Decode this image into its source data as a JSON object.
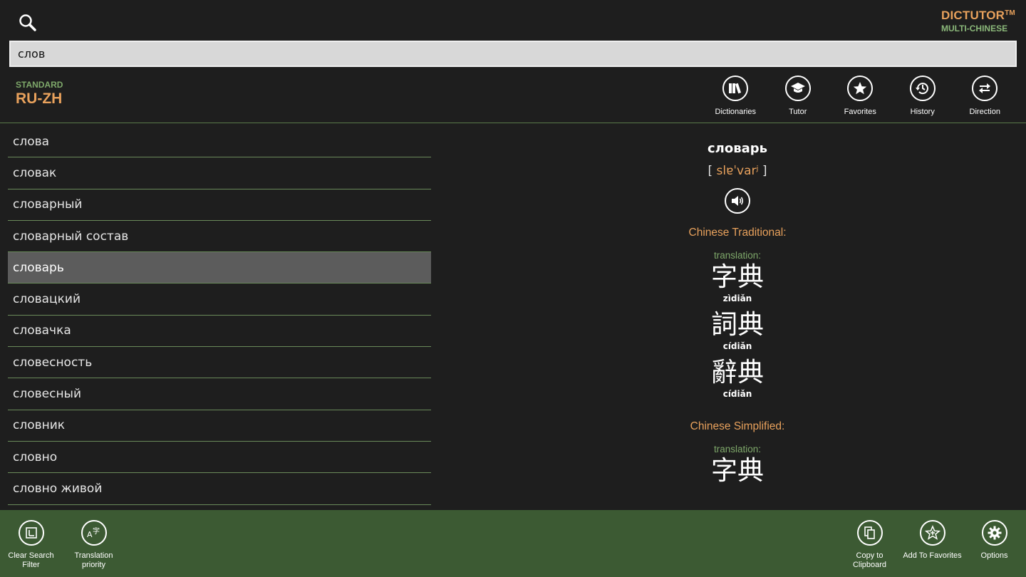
{
  "brand": {
    "name": "DICTUTOR",
    "tm": "TM",
    "subtitle": "MULTI-CHINESE"
  },
  "search": {
    "value": "слов"
  },
  "dictionary": {
    "kind": "STANDARD",
    "pair": "RU-ZH"
  },
  "top_actions": [
    {
      "label": "Dictionaries",
      "icon": "books-icon"
    },
    {
      "label": "Tutor",
      "icon": "graduation-cap-icon"
    },
    {
      "label": "Favorites",
      "icon": "star-icon"
    },
    {
      "label": "History",
      "icon": "history-icon"
    },
    {
      "label": "Direction",
      "icon": "swap-icon"
    }
  ],
  "word_list": [
    "слова",
    "словак",
    "словарный",
    "словарный состав",
    "словарь",
    "словацкий",
    "словачка",
    "словесность",
    "словесный",
    "словник",
    "словно",
    "словно живой"
  ],
  "selected_index": 4,
  "entry": {
    "headword": "словарь",
    "pron_open": "[",
    "pron_ipa": "slɐˈvarʲ",
    "pron_close": "]",
    "traditional": {
      "heading": "Chinese Traditional:",
      "translation_label": "translation:",
      "items": [
        {
          "hanzi": "字典",
          "pinyin": "zìdiǎn"
        },
        {
          "hanzi": "詞典",
          "pinyin": "cídiǎn"
        },
        {
          "hanzi": "辭典",
          "pinyin": "cídiǎn"
        }
      ]
    },
    "simplified": {
      "heading": "Chinese Simplified:",
      "translation_label": "translation:",
      "items": [
        {
          "hanzi": "字典",
          "pinyin": ""
        }
      ]
    }
  },
  "bottom_left": [
    {
      "label_line1": "Clear Search",
      "label_line2": "Filter",
      "icon": "clear-filter-icon"
    },
    {
      "label_line1": "Translation",
      "label_line2": "priority",
      "icon": "translate-icon"
    }
  ],
  "bottom_right": [
    {
      "label_line1": "Copy to",
      "label_line2": "Clipboard",
      "icon": "copy-icon"
    },
    {
      "label_line1": "Add To Favorites",
      "label_line2": "",
      "icon": "add-favorite-icon"
    },
    {
      "label_line1": "Options",
      "label_line2": "",
      "icon": "gear-icon"
    }
  ],
  "colors": {
    "accent_orange": "#e8a15c",
    "accent_green": "#7ea86a",
    "bottom_bar": "#3c5a33",
    "background": "#1e1e1e"
  }
}
